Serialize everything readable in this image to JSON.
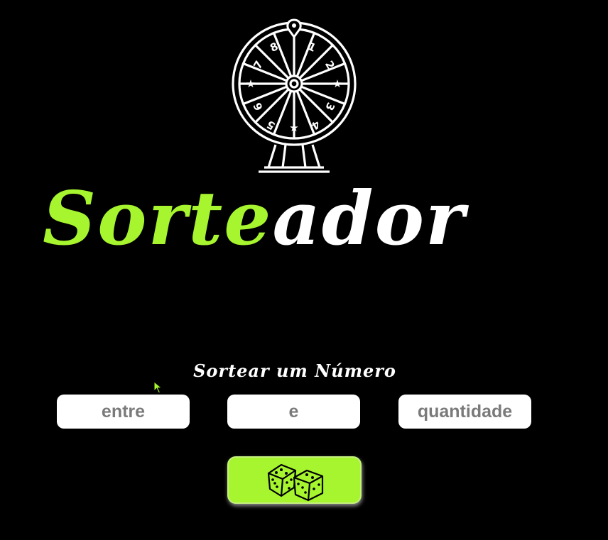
{
  "header": {
    "logo_icon": "prize-wheel-icon",
    "title_part_a": "Sorte",
    "title_part_b": "ador"
  },
  "colors": {
    "background": "#000000",
    "accent": "#a6f52f",
    "text": "#ffffff",
    "field_text": "#7a7a7a"
  },
  "form": {
    "label": "Sortear um Número",
    "fields": [
      {
        "placeholder": "entre"
      },
      {
        "placeholder": "e"
      },
      {
        "placeholder": "quantidade"
      }
    ],
    "submit": {
      "icon": "dice-icon"
    }
  }
}
